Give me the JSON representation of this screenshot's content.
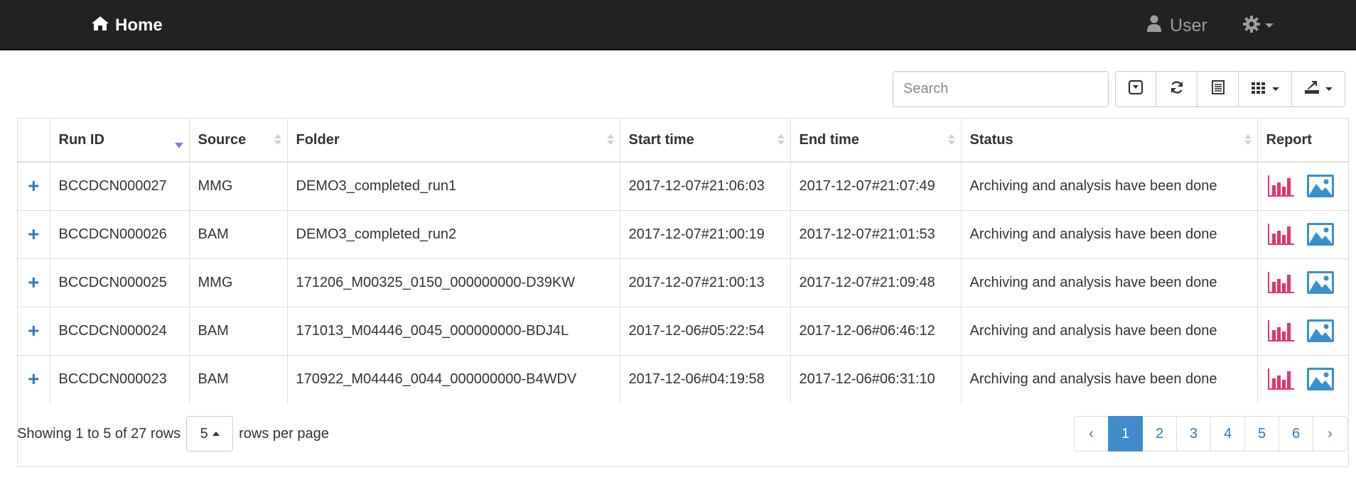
{
  "navbar": {
    "brand_label": "Home",
    "user_label": "User"
  },
  "toolbar": {
    "search_placeholder": "Search",
    "buttons": [
      "toggle-pagination-icon",
      "refresh-icon",
      "toggle-view-icon",
      "columns-icon",
      "export-icon"
    ]
  },
  "table": {
    "columns": [
      "",
      "Run ID",
      "Source",
      "Folder",
      "Start time",
      "End time",
      "Status",
      "Report"
    ],
    "sorted_column": "Run ID",
    "rows": [
      {
        "run_id": "BCCDCN000027",
        "source": "MMG",
        "folder": "DEMO3_completed_run1",
        "start": "2017-12-07#21:06:03",
        "end": "2017-12-07#21:07:49",
        "status": "Archiving and analysis have been done"
      },
      {
        "run_id": "BCCDCN000026",
        "source": "BAM",
        "folder": "DEMO3_completed_run2",
        "start": "2017-12-07#21:00:19",
        "end": "2017-12-07#21:01:53",
        "status": "Archiving and analysis have been done"
      },
      {
        "run_id": "BCCDCN000025",
        "source": "MMG",
        "folder": "171206_M00325_0150_000000000-D39KW",
        "start": "2017-12-07#21:00:13",
        "end": "2017-12-07#21:09:48",
        "status": "Archiving and analysis have been done"
      },
      {
        "run_id": "BCCDCN000024",
        "source": "BAM",
        "folder": "171013_M04446_0045_000000000-BDJ4L",
        "start": "2017-12-06#05:22:54",
        "end": "2017-12-06#06:46:12",
        "status": "Archiving and analysis have been done"
      },
      {
        "run_id": "BCCDCN000023",
        "source": "BAM",
        "folder": "170922_M04446_0044_000000000-B4WDV",
        "start": "2017-12-06#04:19:58",
        "end": "2017-12-06#06:31:10",
        "status": "Archiving and analysis have been done"
      }
    ]
  },
  "footer": {
    "showing_text": "Showing 1 to 5 of 27 rows",
    "page_size": "5",
    "rows_per_page_label": "rows per page"
  },
  "pagination": {
    "prev_label": "‹",
    "pages": [
      "1",
      "2",
      "3",
      "4",
      "5",
      "6"
    ],
    "active_page": "1",
    "next_label": "›"
  },
  "colors": {
    "navbar_bg": "#222222",
    "link": "#337ab7",
    "active_page_bg": "#428bca",
    "chart_icon": "#e8336c",
    "image_icon": "#3a8fd0",
    "sort_active": "#7f7fd5"
  }
}
